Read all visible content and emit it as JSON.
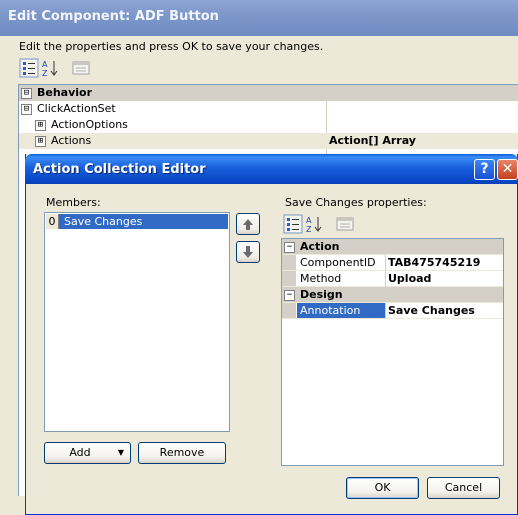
{
  "back_window": {
    "title": "Edit Component: ADF Button",
    "description": "Edit the properties and press OK to save your changes.",
    "grid": {
      "rows": [
        {
          "kind": "category",
          "toggle": "⊟",
          "label": "Behavior",
          "value": ""
        },
        {
          "kind": "property",
          "toggle": "⊟",
          "label": "ClickActionSet",
          "value": ""
        },
        {
          "kind": "property",
          "toggle": "⊞",
          "label": "ActionOptions",
          "value": ""
        },
        {
          "kind": "property",
          "toggle": "⊞",
          "label": "Actions",
          "value": "Action[] Array"
        }
      ]
    }
  },
  "dialog": {
    "title": "Action Collection Editor",
    "help_glyph": "?",
    "close_glyph": "✕",
    "members_label": "Members:",
    "members": [
      {
        "index": "0",
        "name": "Save Changes"
      }
    ],
    "add_label": "Add",
    "remove_label": "Remove",
    "ok_label": "OK",
    "cancel_label": "Cancel",
    "props_label": "Save Changes properties:",
    "properties": {
      "action_category": "Action",
      "component_id_label": "ComponentID",
      "component_id_value": "TAB475745219",
      "method_label": "Method",
      "method_value": "Upload",
      "design_category": "Design",
      "annotation_label": "Annotation",
      "annotation_value": "Save Changes"
    }
  },
  "colors": {
    "xp_title_blue": "#0a5ed7",
    "selection": "#316ac5",
    "dialog_face": "#ece9d8",
    "inactive_title": "#7d97c9"
  },
  "icons": [
    "categorized-icon",
    "alphabetical-icon",
    "property-pages-icon",
    "move-up-icon",
    "move-down-icon",
    "dropdown-arrow-icon",
    "help-icon",
    "close-icon"
  ]
}
